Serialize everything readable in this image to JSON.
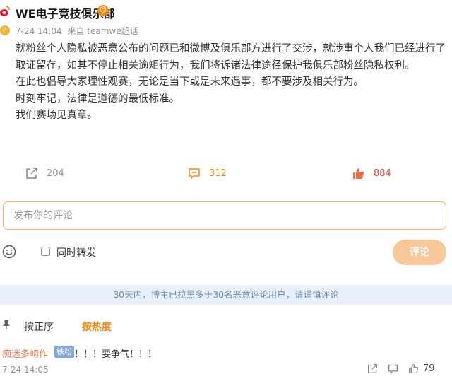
{
  "post": {
    "author": "WE电子竞技俱乐部",
    "time": "7-24 14:04",
    "source": "来自 teamwe超话",
    "paragraphs": [
      "就粉丝个人隐私被恶意公布的问题已和微博及俱乐部方进行了交涉，就涉事个人我们已经进行了取证留存，如其不停止相关逾矩行为，我们将诉诸法律途径保护我俱乐部粉丝隐私权利。",
      "在此也倡导大家理性观赛，无论是当下或是未来遇事，都不要涉及相关行为。",
      "时刻牢记，法律是道德的最低标准。",
      "我们赛场见真章。"
    ],
    "repost_count": "204",
    "comment_count": "312",
    "like_count": "884"
  },
  "composer": {
    "placeholder": "发布你的评论",
    "repost_label": "同时转发",
    "submit_label": "评论"
  },
  "notice": "30天内，博主已拉黑多于30名恶意评论用户，请谨慎评论",
  "sort": {
    "by_time": "按正序",
    "by_hot": "按热度"
  },
  "comments": [
    {
      "user": "痴迷多崎作",
      "badge": "铁粉",
      "text": "！！！要争气！！！",
      "time": "7-24 14:05",
      "likes": "79"
    }
  ],
  "colors": {
    "accent": "#f08a17",
    "username": "#eb7350",
    "notice_bg": "#e8f0fb",
    "submit_bg": "#f9c89a"
  }
}
